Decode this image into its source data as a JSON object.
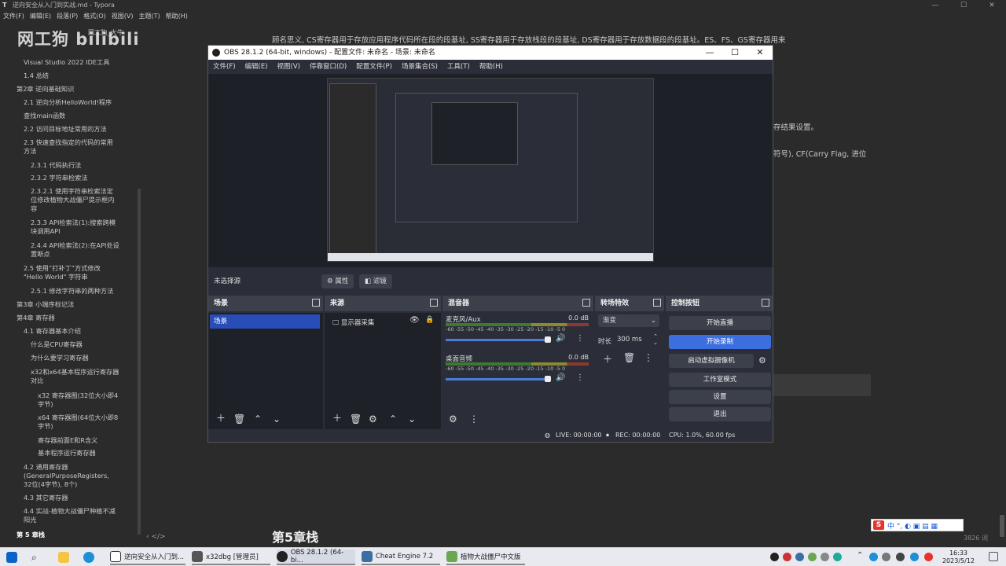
{
  "typora": {
    "title": "逆向安全从入门到实战.md - Typora",
    "window_controls": [
      "—",
      "☐",
      "✕"
    ],
    "menu": [
      "文件(F)",
      "编辑(E)",
      "段落(P)",
      "格式(O)",
      "视图(V)",
      "主题(T)",
      "帮助(H)"
    ],
    "outline": [
      {
        "text": "网工狗_大牛",
        "indent": 0
      },
      {
        "text": "Visual Studio 2022 IDE工具",
        "indent": 1
      },
      {
        "text": "1.4 总结",
        "indent": 1
      },
      {
        "text": "第2章 逆向基础知识",
        "indent": 0
      },
      {
        "text": "2.1 逆向分析HelloWorld!程序",
        "indent": 1
      },
      {
        "text": "查找main函数",
        "indent": 1
      },
      {
        "text": "2.2 访问目标地址常用的方法",
        "indent": 1
      },
      {
        "text": "2.3 快速查找指定的代码的常用",
        "indent": 1
      },
      {
        "text": "方法",
        "indent": 1
      },
      {
        "text": "2.3.1 代码执行法",
        "indent": 2
      },
      {
        "text": "2.3.2 字符串检索法",
        "indent": 2
      },
      {
        "text": "2.3.2.1 使用字符串检索法定",
        "indent": 2
      },
      {
        "text": "位修改植物大战僵尸提示框内",
        "indent": 2
      },
      {
        "text": "容",
        "indent": 2
      },
      {
        "text": "2.3.3 API检索法(1):搜索跨模",
        "indent": 2
      },
      {
        "text": "块调用API",
        "indent": 2
      },
      {
        "text": "2.4.4 API检索法(2):在API处设",
        "indent": 2
      },
      {
        "text": "置断点",
        "indent": 2
      },
      {
        "text": "2.5 使用“打补丁”方式修改",
        "indent": 1
      },
      {
        "text": "\"Hello World\" 字符串",
        "indent": 1
      },
      {
        "text": "2.5.1 修改字符串的两种方法",
        "indent": 2
      },
      {
        "text": "第3章 小端序标记法",
        "indent": 0
      },
      {
        "text": "第4章 寄存器",
        "indent": 0
      },
      {
        "text": "4.1 寄存器基本介绍",
        "indent": 1
      },
      {
        "text": "什么是CPU寄存器",
        "indent": 2
      },
      {
        "text": "为什么要学习寄存器",
        "indent": 2
      },
      {
        "text": "x32和x64基本程序运行寄存器",
        "indent": 2
      },
      {
        "text": "对比",
        "indent": 2
      },
      {
        "text": "x32 寄存器图(32位大小即4",
        "indent": 3
      },
      {
        "text": "字节)",
        "indent": 3
      },
      {
        "text": "x64 寄存器图(64位大小即8",
        "indent": 3
      },
      {
        "text": "字节)",
        "indent": 3
      },
      {
        "text": "寄存器前面E和R含义",
        "indent": 3
      },
      {
        "text": "基本程序运行寄存器",
        "indent": 3
      },
      {
        "text": "4.2 通用寄存器",
        "indent": 1
      },
      {
        "text": "(GeneralPurposeRegisters,",
        "indent": 1
      },
      {
        "text": "32位(4字节), 8个)",
        "indent": 1
      },
      {
        "text": "4.3 其它寄存器",
        "indent": 1
      },
      {
        "text": "4.4 实战-植物大战僵尸种植不减",
        "indent": 1
      },
      {
        "text": "阳光",
        "indent": 1
      },
      {
        "text": "第 5 章栈",
        "indent": 0
      }
    ],
    "bottom_icons": "‹   </>",
    "watermark": "网工狗 bilibili",
    "doc_lines": [
      "顾名思义, CS寄存器用于存放应用程序代码所在段的段基址, SS寄存器用于存放栈段的段基址, DS寄存器用于存放数据段的段基址。ES、FS、GS寄存器用来",
      "存结果设置。",
      "符号), CF(Carry Flag, 进位"
    ],
    "chapter_heading": "第5章栈",
    "word_count": "3826 词"
  },
  "obs": {
    "title": "OBS 28.1.2 (64-bit, windows) - 配置文件: 未命名 - 场景: 未命名",
    "window_controls": [
      "—",
      "☐",
      "✕"
    ],
    "menu": [
      "文件(F)",
      "编辑(E)",
      "视图(V)",
      "停靠窗口(D)",
      "配置文件(P)",
      "场景集合(S)",
      "工具(T)",
      "帮助(H)"
    ],
    "no_source": "未选择源",
    "properties_btn": "属性",
    "filters_btn": "滤镜",
    "docks": {
      "scenes": {
        "title": "场景",
        "items": [
          "场景"
        ]
      },
      "sources": {
        "title": "来源",
        "items": [
          "显示器采集"
        ]
      },
      "mixer": {
        "title": "混音器",
        "channels": [
          {
            "name": "麦克风/Aux",
            "db": "0.0 dB"
          },
          {
            "name": "桌面音频",
            "db": "0.0 dB"
          }
        ],
        "scale": "-60 -55 -50 -45 -40 -35 -30 -25 -20 -15 -10 -5 0"
      },
      "transitions": {
        "title": "转场特效",
        "selected": "渐变",
        "duration_label": "时长",
        "duration_value": "300 ms"
      },
      "controls": {
        "title": "控制按钮",
        "buttons": [
          "开始直播",
          "开始录制",
          "启动虚拟摄像机",
          "工作室模式",
          "设置",
          "退出"
        ]
      }
    },
    "status": {
      "live": "LIVE: 00:00:00",
      "rec": "REC: 00:00:00",
      "cpu": "CPU: 1.0%, 60.00 fps"
    }
  },
  "ime": {
    "label": "中 °, ◐ ▣ ▤ ▦"
  },
  "taskbar": {
    "apps": [
      {
        "label": "逆向安全从入门到..."
      },
      {
        "label": "x32dbg [管理员]"
      },
      {
        "label": "OBS 28.1.2 (64-bi..."
      },
      {
        "label": "Cheat Engine 7.2"
      },
      {
        "label": "植物大战僵尸中文版"
      }
    ],
    "time": "16:33",
    "date": "2023/5/12"
  }
}
